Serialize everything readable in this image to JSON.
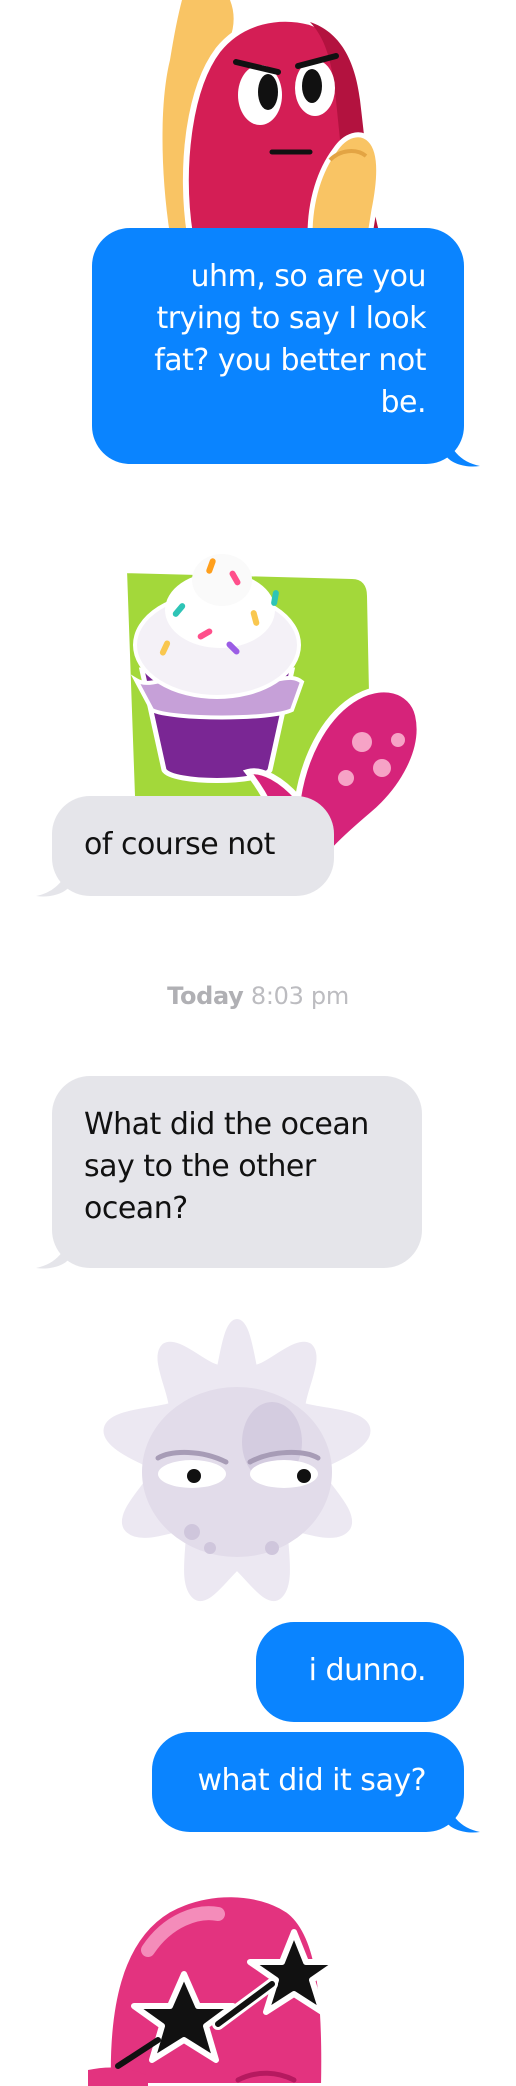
{
  "messages": [
    {
      "direction": "outgoing",
      "text": "uhm, so are you\ntrying to say I look\nfat? you better not\nbe."
    },
    {
      "direction": "incoming",
      "text": "of course not"
    },
    {
      "direction": "incoming",
      "text": "What did the ocean\nsay to the other\nocean?"
    },
    {
      "direction": "outgoing",
      "text": "i dunno."
    },
    {
      "direction": "outgoing",
      "text": "what did it say?"
    }
  ],
  "timestamp": {
    "day": "Today",
    "time": "8:03 pm"
  },
  "stickers": [
    {
      "name": "worried-red-blob-sticker"
    },
    {
      "name": "cupcake-tentacle-sticker"
    },
    {
      "name": "grumpy-white-star-sticker"
    },
    {
      "name": "pink-blob-star-glasses-sticker"
    }
  ],
  "colors": {
    "outgoing_bubble": "#0a84ff",
    "incoming_bubble": "#e5e5ea",
    "timestamp_text": "#bcbcc0"
  }
}
